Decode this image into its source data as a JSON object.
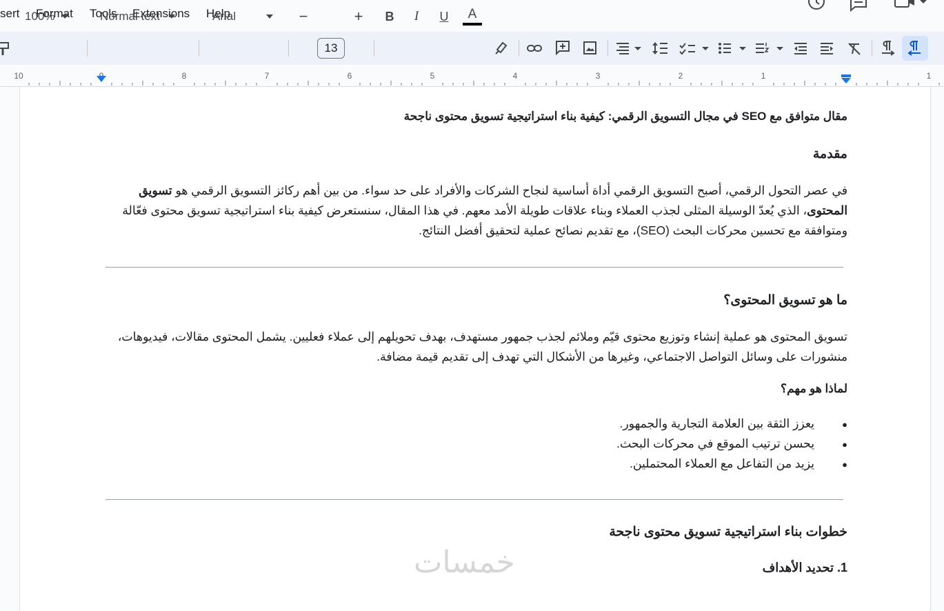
{
  "menu": {
    "items": [
      "sert",
      "Format",
      "Tools",
      "Extensions",
      "Help"
    ]
  },
  "toolbar": {
    "zoom": "100%",
    "style": "Normal text",
    "font": "Arial",
    "font_size": "13",
    "minus": "−",
    "plus": "+",
    "bold": "B",
    "italic": "I",
    "underline": "U",
    "text_color": "A",
    "text_color_hex": "#000000",
    "icons": [
      "paint-format-icon",
      "bold-icon",
      "italic-icon",
      "underline-icon",
      "text-color-icon",
      "highlight-icon",
      "link-icon",
      "add-comment-icon",
      "insert-image-icon",
      "align-icon",
      "line-spacing-icon",
      "checklist-icon",
      "bulleted-list-icon",
      "numbered-list-icon",
      "decrease-indent-icon",
      "increase-indent-icon",
      "clear-formatting-icon",
      "ltr-icon",
      "rtl-icon"
    ]
  },
  "ruler": {
    "numbers": [
      "10",
      "9",
      "8",
      "7",
      "6",
      "5",
      "4",
      "3",
      "2",
      "1",
      "1"
    ]
  },
  "document": {
    "title": "مقال متوافق مع SEO في مجال التسويق الرقمي: كيفية بناء استراتيجية تسويق محتوى ناجحة",
    "intro_heading": "مقدمة",
    "intro_p1": "في عصر التحول الرقمي، أصبح التسويق الرقمي أداة أساسية لنجاح الشركات والأفراد على حد سواء. من بين أهم ركائز التسويق الرقمي هو ",
    "intro_bold": "تسويق المحتوى",
    "intro_p2": "، الذي يُعدّ الوسيلة المثلى لجذب العملاء وبناء علاقات طويلة الأمد معهم. في هذا المقال، سنستعرض كيفية بناء استراتيجية تسويق محتوى فعّالة ومتوافقة مع تحسين محركات البحث (SEO)، مع تقديم نصائح عملية لتحقيق أفضل النتائج.",
    "what_heading": "ما هو تسويق المحتوى؟",
    "what_p": "تسويق المحتوى هو عملية إنشاء وتوزيع محتوى قيّم وملائم لجذب جمهور مستهدف، بهدف تحويلهم إلى عملاء فعليين. يشمل المحتوى مقالات، فيديوهات، منشورات على وسائل التواصل الاجتماعي، وغيرها من الأشكال التي تهدف إلى تقديم قيمة مضافة.",
    "why_heading": "لماذا هو مهم؟",
    "bullets": [
      "يعزز الثقة بين العلامة التجارية والجمهور.",
      "يحسن ترتيب الموقع في محركات البحث.",
      "يزيد من التفاعل مع العملاء المحتملين."
    ],
    "steps_heading": "خطوات بناء استراتيجية تسويق محتوى ناجحة",
    "step1_heading": "1. تحديد الأهداف",
    "watermark": "خمسات"
  },
  "colors": {
    "accent": "#1a73e8",
    "toolbar_bg": "#edf2fa",
    "page_bg": "#f9fbfd"
  }
}
